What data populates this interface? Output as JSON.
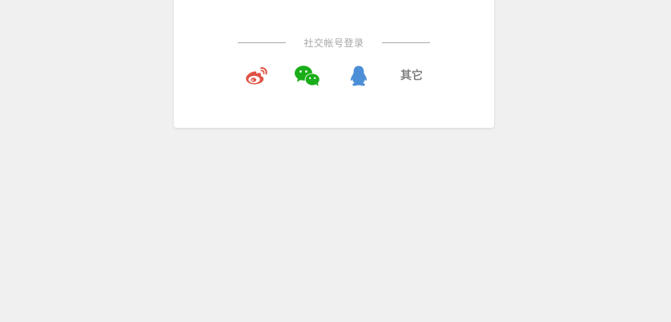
{
  "social_login": {
    "divider_label": "社交帐号登录",
    "providers": [
      {
        "name": "weibo",
        "icon": "weibo-icon",
        "color": "#e05244"
      },
      {
        "name": "wechat",
        "icon": "wechat-icon",
        "color": "#1aad19"
      },
      {
        "name": "qq",
        "icon": "qq-icon",
        "color": "#4d8fd6"
      }
    ],
    "other_label": "其它"
  },
  "colors": {
    "page_background": "#f0f0f0",
    "card_background": "#ffffff",
    "divider_line": "#a8a8a8",
    "divider_text": "#a6a6a6",
    "other_text": "#808080"
  }
}
